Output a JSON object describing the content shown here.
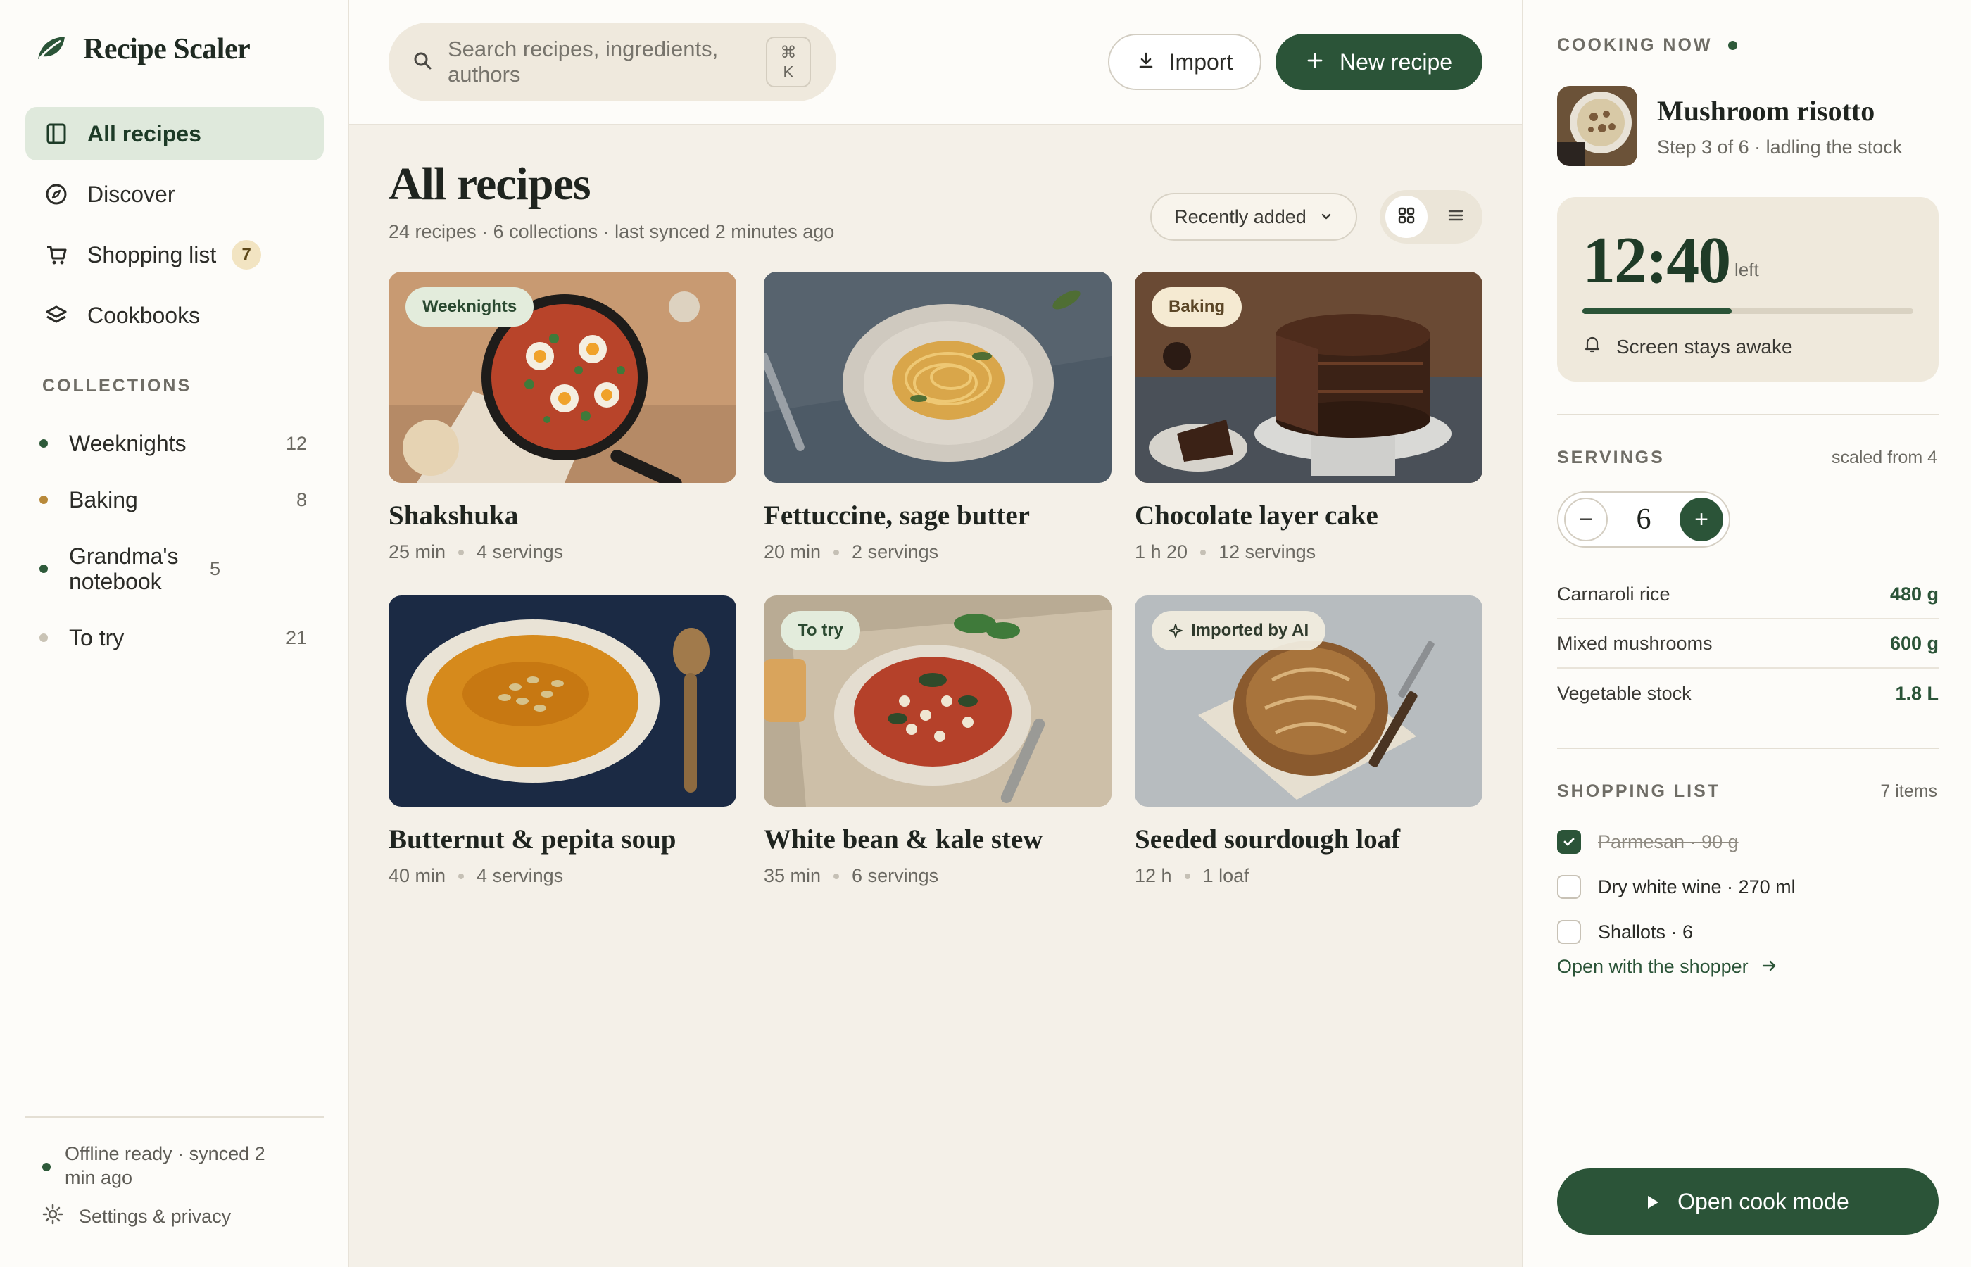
{
  "app": {
    "name": "Recipe Scaler"
  },
  "sidebar": {
    "nav": [
      {
        "label": "All recipes",
        "icon": "book-icon",
        "active": true
      },
      {
        "label": "Discover",
        "icon": "compass-icon"
      },
      {
        "label": "Shopping list",
        "icon": "cart-icon",
        "badge": "7"
      },
      {
        "label": "Cookbooks",
        "icon": "layers-icon"
      }
    ],
    "collections_heading": "COLLECTIONS",
    "collections": [
      {
        "name": "Weeknights",
        "count": "12",
        "color": "#2e5a3a"
      },
      {
        "name": "Baking",
        "count": "8",
        "color": "#b8893a"
      },
      {
        "name": "Grandma's notebook",
        "count": "5",
        "color": "#2e5a3a"
      },
      {
        "name": "To try",
        "count": "21",
        "color": "#c9c3b5"
      }
    ],
    "sync_status": "Offline ready · synced 2 min ago",
    "settings_label": "Settings & privacy"
  },
  "topbar": {
    "search_placeholder": "Search recipes, ingredients, authors",
    "shortcut_symbol": "⌘",
    "shortcut_key": "K",
    "import_label": "Import",
    "new_recipe_label": "New recipe"
  },
  "main": {
    "title": "All recipes",
    "subtitle": "24 recipes · 6 collections · last synced 2 minutes ago",
    "sort_label": "Recently added",
    "view_mode": "grid",
    "recipes": [
      {
        "title": "Shakshuka",
        "time": "25 min",
        "yield": "4 servings",
        "tag": "Weeknights"
      },
      {
        "title": "Fettuccine, sage butter",
        "time": "20 min",
        "yield": "2 servings",
        "tag": ""
      },
      {
        "title": "Chocolate layer cake",
        "time": "1 h 20",
        "yield": "12 servings",
        "tag": "Baking"
      },
      {
        "title": "Butternut & pepita soup",
        "time": "40 min",
        "yield": "4 servings",
        "tag": ""
      },
      {
        "title": "White bean & kale stew",
        "time": "35 min",
        "yield": "6 servings",
        "tag": "To try"
      },
      {
        "title": "Seeded sourdough loaf",
        "time": "12 h",
        "yield": "1 loaf",
        "tag": "Imported by AI"
      }
    ]
  },
  "panel": {
    "cooking_label": "COOKING NOW",
    "now_title": "Mushroom risotto",
    "now_step": "Step 3 of 6 · ladling the stock",
    "timer_value": "12:40",
    "timer_unit": "left",
    "timer_progress": 0.45,
    "awake_label": "Screen stays awake",
    "servings_label": "SERVINGS",
    "servings_scaled_from": "scaled from 4",
    "servings_value": "6",
    "minus_label": "−",
    "plus_label": "+",
    "ingredients": [
      {
        "name": "Carnaroli rice",
        "amount": "480 g"
      },
      {
        "name": "Mixed mushrooms",
        "amount": "600 g"
      },
      {
        "name": "Vegetable stock",
        "amount": "1.8 L"
      }
    ],
    "shopping_label": "SHOPPING LIST",
    "shopping_count": "7 items",
    "shopping_items": [
      {
        "text": "Parmesan · 90 g",
        "checked": true
      },
      {
        "text": "Dry white wine · 270 ml",
        "checked": false
      },
      {
        "text": "Shallots · 6",
        "checked": false
      }
    ],
    "shopper_link": "Open with the shopper",
    "cook_mode_label": "Open cook mode"
  },
  "colors": {
    "accent": "#2b5438",
    "background": "#f4f0e8",
    "surface": "#fdfcf9"
  }
}
